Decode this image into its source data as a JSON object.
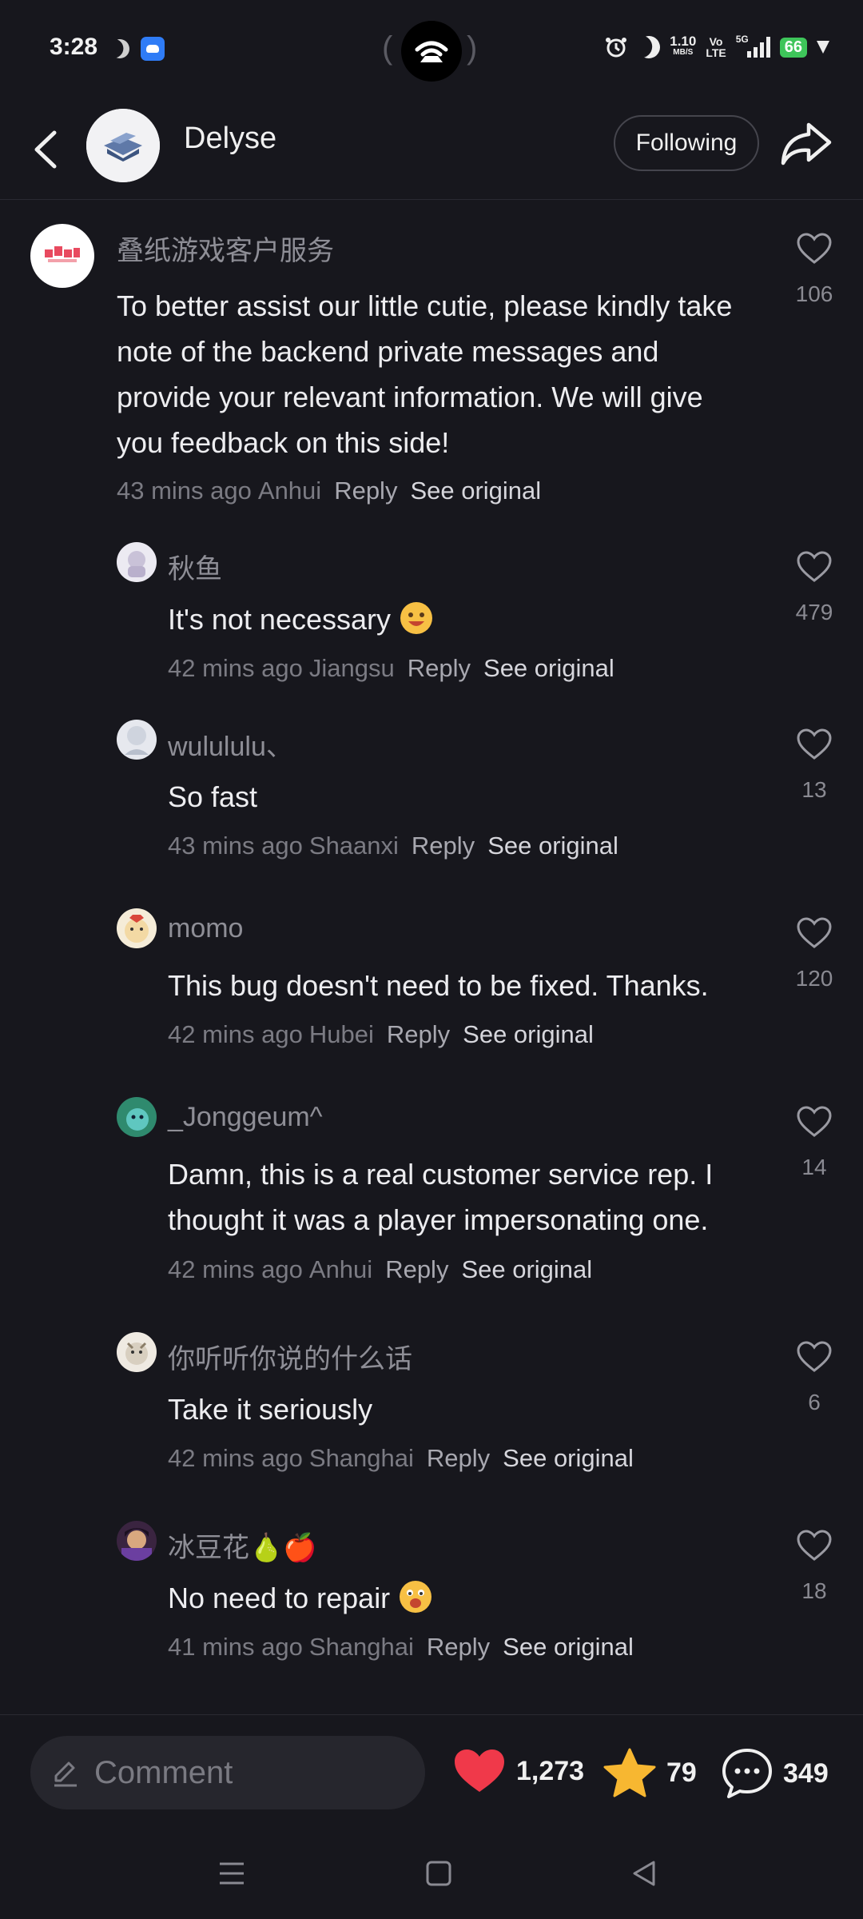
{
  "status_bar": {
    "time": "3:28",
    "net_speed_value": "1.10",
    "net_speed_unit": "MB/S",
    "volte_top": "Vo",
    "volte_bottom": "LTE",
    "network_type": "5G",
    "battery": "66",
    "icons": [
      "moon-icon",
      "app-notification-icon",
      "hotspot-icon",
      "alarm-icon",
      "do-not-disturb-icon",
      "signal-icon",
      "charging-icon"
    ]
  },
  "header": {
    "name": "Delyse",
    "following_label": "Following"
  },
  "comments": [
    {
      "username": "叠纸游戏客户服务",
      "content": "To better assist our little cutie, please kindly take note of the backend private messages and provide your relevant information. We will give you feedback on this side!",
      "time": "43 mins ago",
      "location": "Anhui",
      "reply": "Reply",
      "see_original": "See original",
      "likes": "106"
    },
    {
      "username": "秋鱼",
      "content": "It's not necessary",
      "emoji": "laughing-face",
      "time": "42 mins ago",
      "location": "Jiangsu",
      "reply": "Reply",
      "see_original": "See original",
      "likes": "479"
    },
    {
      "username": "wulululu、",
      "content": "So fast",
      "time": "43 mins ago",
      "location": "Shaanxi",
      "reply": "Reply",
      "see_original": "See original",
      "likes": "13"
    },
    {
      "username": "momo",
      "content": "This bug doesn't need to be fixed. Thanks.",
      "time": "42 mins ago",
      "location": "Hubei",
      "reply": "Reply",
      "see_original": "See original",
      "likes": "120"
    },
    {
      "username": "_Jonggeum^",
      "content": "Damn, this is a real customer service rep. I thought it was a player impersonating one.",
      "time": "42 mins ago",
      "location": "Anhui",
      "reply": "Reply",
      "see_original": "See original",
      "likes": "14"
    },
    {
      "username": "你听听你说的什么话",
      "content": "Take it seriously",
      "time": "42 mins ago",
      "location": "Shanghai",
      "reply": "Reply",
      "see_original": "See original",
      "likes": "6"
    },
    {
      "username": "冰豆花",
      "username_emoji": "🍐🍎",
      "content": "No need to repair",
      "emoji": "smiling-face",
      "time": "41 mins ago",
      "location": "Shanghai",
      "reply": "Reply",
      "see_original": "See original",
      "likes": "18"
    }
  ],
  "bottom_bar": {
    "comment_placeholder": "Comment",
    "likes": "1,273",
    "stars": "79",
    "comments": "349"
  },
  "colors": {
    "background": "#17171d",
    "like_red": "#f0394a",
    "star_yellow": "#f7b731",
    "battery_green": "#3ec55a"
  }
}
